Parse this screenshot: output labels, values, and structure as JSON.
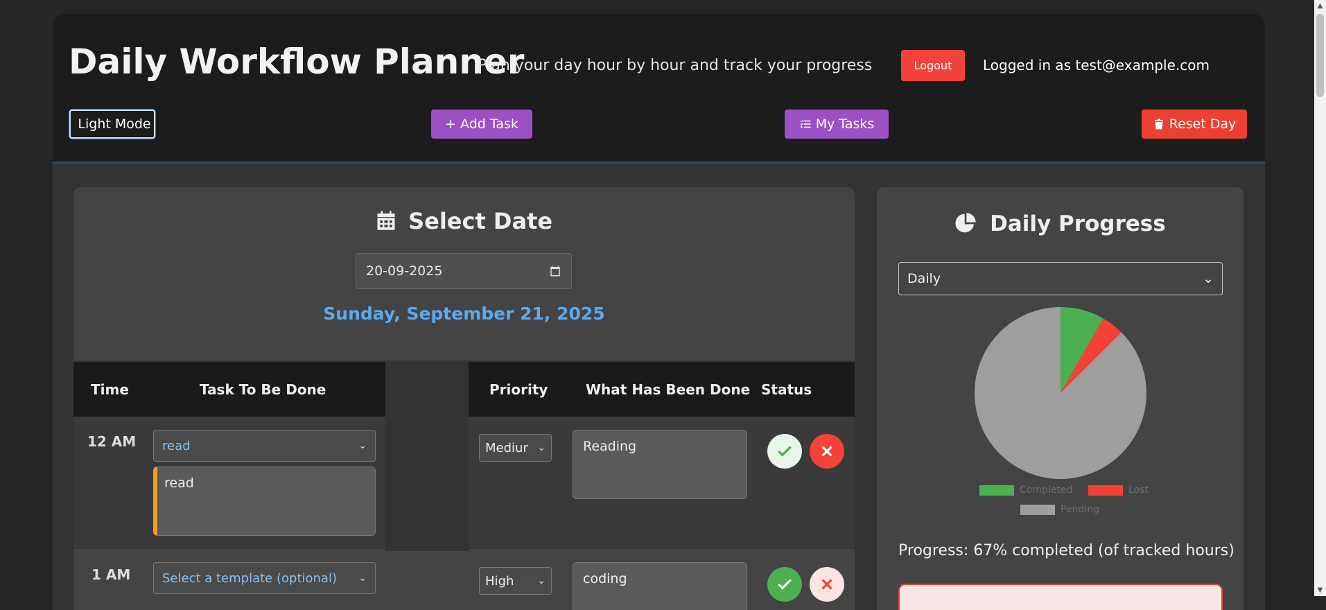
{
  "header": {
    "title": "Daily Workflow Planner",
    "subtitle": "Plan your day hour by hour and track your progress",
    "logout_label": "Logout",
    "logged_in_text": "Logged in as test@example.com"
  },
  "toolbar": {
    "light_mode_label": "Light Mode",
    "add_task_label": "+ Add Task",
    "my_tasks_label": "My Tasks",
    "reset_day_label": "Reset Day"
  },
  "date_panel": {
    "title": "Select Date",
    "date_value": "20-09-2025",
    "long_date": "Sunday, September 21, 2025"
  },
  "table": {
    "headers": {
      "time": "Time",
      "task": "Task To Be Done",
      "priority": "Priority",
      "done": "What Has Been Done",
      "status": "Status"
    },
    "rows": [
      {
        "time": "12 AM",
        "template": "read",
        "task_text": "read",
        "priority": "Mediur",
        "done_text": "Reading",
        "status": "none"
      },
      {
        "time": "1 AM",
        "template": "Select a template (optional)",
        "task_text": "",
        "priority": "High",
        "done_text": "coding",
        "status": "completed"
      }
    ]
  },
  "progress": {
    "title": "Daily Progress",
    "period_selected": "Daily",
    "legend": {
      "completed": "Completed",
      "lost": "Lost",
      "pending": "Pending"
    },
    "progress_text": "Progress: 67% completed (of tracked hours)",
    "colors": {
      "completed": "#4caf50",
      "lost": "#f44336",
      "pending": "#9e9e9e"
    }
  },
  "chart_data": {
    "type": "pie",
    "categories": [
      "Completed",
      "Lost",
      "Pending"
    ],
    "values": [
      8.3,
      4.2,
      87.5
    ]
  }
}
